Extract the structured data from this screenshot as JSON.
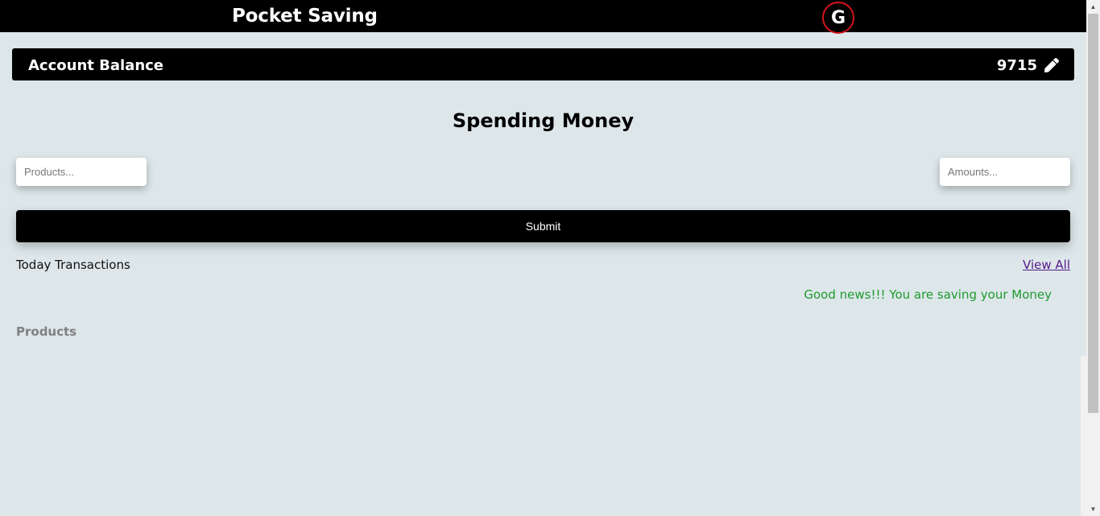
{
  "header": {
    "title": "Pocket Saving",
    "avatar_letter": "G"
  },
  "balance": {
    "label": "Account Balance",
    "value": "9715",
    "edit_icon": "pencil-icon"
  },
  "spending": {
    "title": "Spending Money",
    "products_placeholder": "Products...",
    "amounts_placeholder": "Amounts...",
    "submit_label": "Submit"
  },
  "transactions": {
    "today_label": "Today Transactions",
    "view_all_label": "View All",
    "status_message": "Good news!!! You are saving your Money",
    "products_heading": "Products"
  },
  "colors": {
    "background": "#dde7ea",
    "bar": "#000000",
    "avatar_ring": "#d4141c",
    "good_news": "#1f9a2e",
    "link": "#551a8b"
  }
}
